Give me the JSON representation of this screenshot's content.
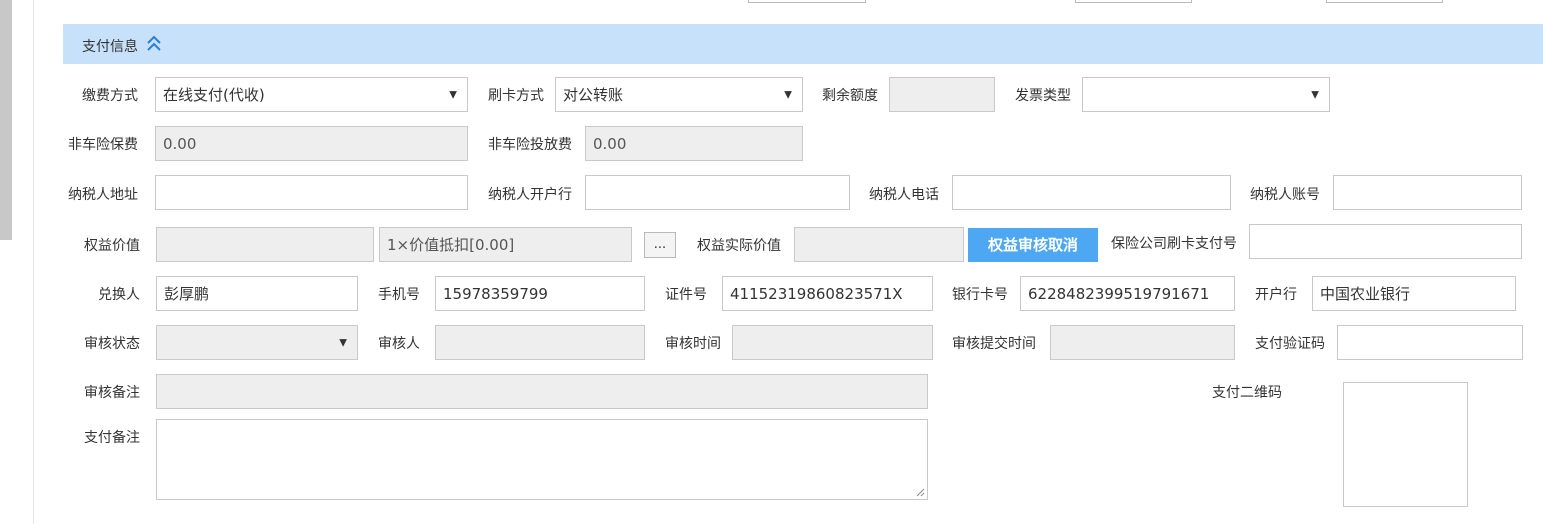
{
  "section": {
    "title": "支付信息",
    "collapse_icon": "chevron-double-up-icon",
    "header_color": "#c6e1f9"
  },
  "row1": {
    "payment_method_label": "缴费方式",
    "payment_method_value": "在线支付(代收)",
    "card_method_label": "刷卡方式",
    "card_method_value": "对公转账",
    "remaining_label": "剩余额度",
    "remaining_value": "",
    "invoice_type_label": "发票类型",
    "invoice_type_value": ""
  },
  "row2": {
    "non_auto_premium_label": "非车险保费",
    "non_auto_premium_value": "0.00",
    "non_auto_deploy_label": "非车险投放费",
    "non_auto_deploy_value": "0.00"
  },
  "row3": {
    "taxpayer_address_label": "纳税人地址",
    "taxpayer_address_value": "",
    "taxpayer_bank_label": "纳税人开户行",
    "taxpayer_bank_value": "",
    "taxpayer_phone_label": "纳税人电话",
    "taxpayer_phone_value": "",
    "taxpayer_account_label": "纳税人账号",
    "taxpayer_account_value": ""
  },
  "row4": {
    "equity_value_label": "权益价值",
    "equity_value_value": "",
    "equity_deduct_value": "1×价值抵扣[0.00]",
    "dots_button_label": "...",
    "equity_actual_label": "权益实际价值",
    "equity_actual_value": "",
    "cancel_review_button_label": "权益审核取消",
    "insurer_card_pay_label": "保险公司刷卡支付号",
    "insurer_card_pay_value": "",
    "primary_color": "#4da7f2"
  },
  "row5": {
    "redeemer_label": "兑换人",
    "redeemer_value": "彭厚鹏",
    "mobile_label": "手机号",
    "mobile_value": "15978359799",
    "id_label": "证件号",
    "id_value": "41152319860823571X",
    "bank_card_label": "银行卡号",
    "bank_card_value": "6228482399519791671",
    "bank_label": "开户行",
    "bank_value": "中国农业银行"
  },
  "row6": {
    "review_status_label": "审核状态",
    "review_status_value": "",
    "reviewer_label": "审核人",
    "reviewer_value": "",
    "review_time_label": "审核时间",
    "review_time_value": "",
    "review_submit_time_label": "审核提交时间",
    "review_submit_time_value": "",
    "pay_code_label": "支付验证码",
    "pay_code_value": ""
  },
  "row7": {
    "review_remark_label": "审核备注",
    "review_remark_value": "",
    "pay_qr_label": "支付二维码"
  },
  "row8": {
    "pay_remark_label": "支付备注",
    "pay_remark_value": ""
  }
}
